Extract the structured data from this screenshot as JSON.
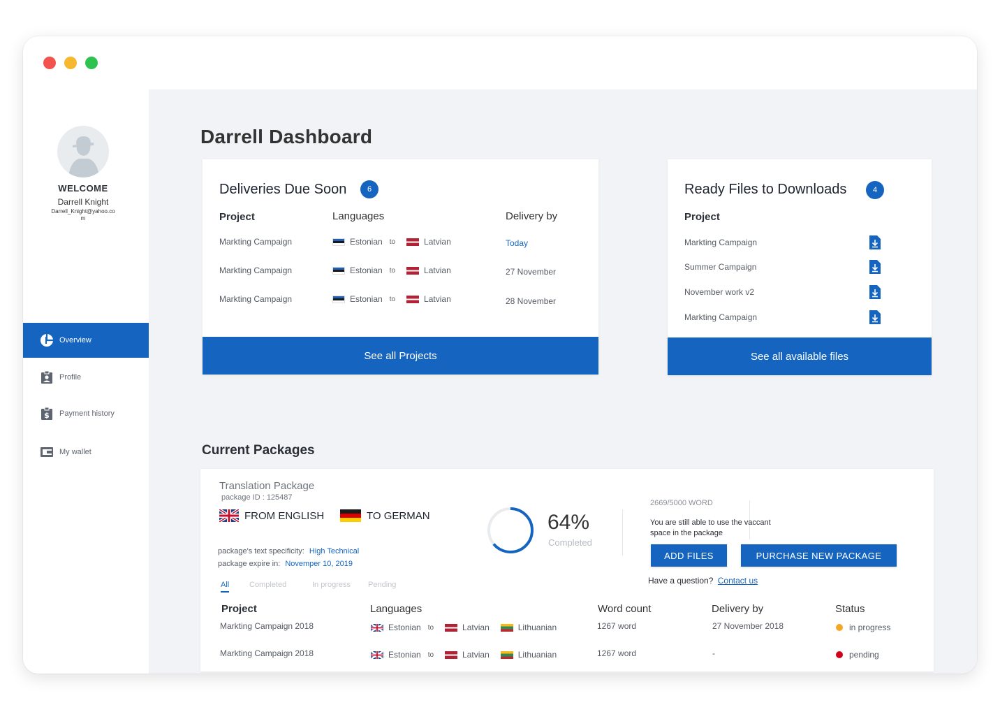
{
  "user": {
    "welcome": "WELCOME",
    "name": "Darrell Knight",
    "email": "Darrell_Knight@yahoo.co\nm"
  },
  "nav": [
    {
      "label": "Overview",
      "icon": "pie-chart-icon",
      "active": true
    },
    {
      "label": "Profile",
      "icon": "id-badge-icon",
      "active": false
    },
    {
      "label": "Payment history",
      "icon": "dollar-clipboard-icon",
      "active": false
    },
    {
      "label": "My wallet",
      "icon": "wallet-icon",
      "active": false
    }
  ],
  "page_title": "Darrell Dashboard",
  "deliveries": {
    "title": "Deliveries Due Soon",
    "count": "6",
    "headers": {
      "project": "Project",
      "languages": "Languages",
      "delivery": "Delivery by"
    },
    "rows": [
      {
        "project": "Markting Campaign",
        "from": "Estonian",
        "to_word": "to",
        "to": "Latvian",
        "delivery": "Today"
      },
      {
        "project": "Markting Campaign",
        "from": "Estonian",
        "to_word": "to",
        "to": "Latvian",
        "delivery": "27 November"
      },
      {
        "project": "Markting Campaign",
        "from": "Estonian",
        "to_word": "to",
        "to": "Latvian",
        "delivery": "28 November"
      }
    ],
    "footer": "See all Projects"
  },
  "downloads": {
    "title": "Ready Files to Downloads",
    "count": "4",
    "header": "Project",
    "files": [
      "Markting Campaign",
      "Summer Campaign",
      "November work v2",
      "Markting Campaign"
    ],
    "footer": "See all available files"
  },
  "packages": {
    "section_title": "Current Packages",
    "name": "Translation Package",
    "package_id": "package ID : 125487",
    "from": "FROM ENGLISH",
    "to": "TO GERMAN",
    "specificity_label": "package's text specificity:",
    "specificity_value": "High Technical",
    "expire_label": "package expire in:",
    "expire_value": "Novemper 10, 2019",
    "progress": 64,
    "progress_text": "64%",
    "progress_caption": "Completed",
    "words": "2669/5000 WORD",
    "note": "You are still able to use the vaccant\nspace in the package",
    "add_files": "ADD FILES",
    "purchase": "PURCHASE NEW PACKAGE",
    "question": "Have a question?",
    "contact": "Contact us",
    "tabs": [
      "All",
      "Completed",
      "In progress",
      "Pending"
    ],
    "headers": {
      "project": "Project",
      "languages": "Languages",
      "words": "Word count",
      "delivery": "Delivery by",
      "status": "Status"
    },
    "rows": [
      {
        "project": "Markting Campaign 2018",
        "from": "Estonian",
        "to_word": "to",
        "to1": "Latvian",
        "to2": "Lithuanian",
        "words": "1267 word",
        "delivery": "27 November 2018",
        "status": "in progress",
        "status_color": "#f5a623"
      },
      {
        "project": "Markting Campaign 2018",
        "from": "Estonian",
        "to_word": "to",
        "to1": "Latvian",
        "to2": "Lithuanian",
        "words": "1267 word",
        "delivery": "-",
        "status": "pending",
        "status_color": "#d0021b"
      }
    ]
  },
  "colors": {
    "accent": "#1565c0",
    "background": "#f2f3f6"
  }
}
